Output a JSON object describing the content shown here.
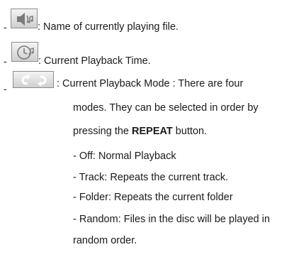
{
  "items": [
    {
      "icon": "speaker-note-icon",
      "bullet": "-",
      "text": ": Name of currently playing file."
    },
    {
      "icon": "clock-icon",
      "bullet": "-",
      "text": ": Current Playback Time."
    },
    {
      "icon": "repeat-arrows-icon",
      "bullet": "-",
      "text": ": Current Playback Mode : There are four"
    }
  ],
  "continuation": {
    "line1": "modes. They can be selected in order by",
    "line2_prefix": "pressing the ",
    "line2_bold": "REPEAT",
    "line2_suffix": " button."
  },
  "modes": [
    "- Off: Normal Playback",
    "- Track: Repeats the current track.",
    "- Folder: Repeats the current folder",
    "- Random: Files in the disc will be played in"
  ],
  "modes_wrap": "random order."
}
